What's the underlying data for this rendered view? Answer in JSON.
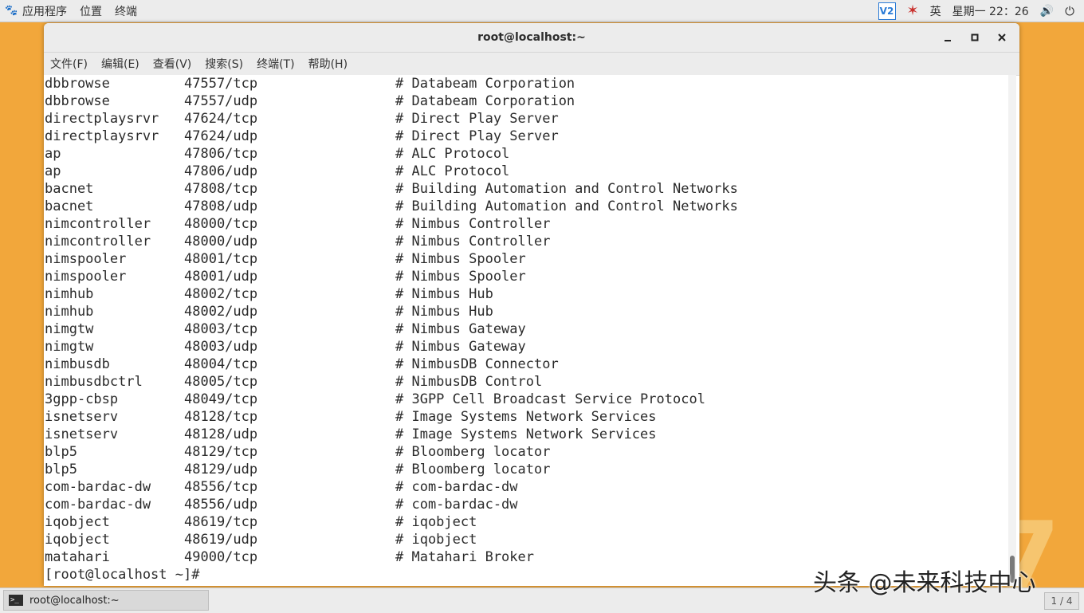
{
  "desktop": {
    "decor": "7"
  },
  "top_panel": {
    "apps": "应用程序",
    "places": "位置",
    "terminal": "终端",
    "tray_v": "V2",
    "ime": "英",
    "clock": "星期一 22：26"
  },
  "window": {
    "title": "root@localhost:~",
    "menu": [
      "文件(F)",
      "编辑(E)",
      "查看(V)",
      "搜索(S)",
      "终端(T)",
      "帮助(H)"
    ]
  },
  "terminal": {
    "lines": [
      {
        "name": "dbbrowse",
        "port": "47557/tcp",
        "desc": "# Databeam Corporation"
      },
      {
        "name": "dbbrowse",
        "port": "47557/udp",
        "desc": "# Databeam Corporation"
      },
      {
        "name": "directplaysrvr",
        "port": "47624/tcp",
        "desc": "# Direct Play Server"
      },
      {
        "name": "directplaysrvr",
        "port": "47624/udp",
        "desc": "# Direct Play Server"
      },
      {
        "name": "ap",
        "port": "47806/tcp",
        "desc": "# ALC Protocol"
      },
      {
        "name": "ap",
        "port": "47806/udp",
        "desc": "# ALC Protocol"
      },
      {
        "name": "bacnet",
        "port": "47808/tcp",
        "desc": "# Building Automation and Control Networks"
      },
      {
        "name": "bacnet",
        "port": "47808/udp",
        "desc": "# Building Automation and Control Networks"
      },
      {
        "name": "nimcontroller",
        "port": "48000/tcp",
        "desc": "# Nimbus Controller"
      },
      {
        "name": "nimcontroller",
        "port": "48000/udp",
        "desc": "# Nimbus Controller"
      },
      {
        "name": "nimspooler",
        "port": "48001/tcp",
        "desc": "# Nimbus Spooler"
      },
      {
        "name": "nimspooler",
        "port": "48001/udp",
        "desc": "# Nimbus Spooler"
      },
      {
        "name": "nimhub",
        "port": "48002/tcp",
        "desc": "# Nimbus Hub"
      },
      {
        "name": "nimhub",
        "port": "48002/udp",
        "desc": "# Nimbus Hub"
      },
      {
        "name": "nimgtw",
        "port": "48003/tcp",
        "desc": "# Nimbus Gateway"
      },
      {
        "name": "nimgtw",
        "port": "48003/udp",
        "desc": "# Nimbus Gateway"
      },
      {
        "name": "nimbusdb",
        "port": "48004/tcp",
        "desc": "# NimbusDB Connector"
      },
      {
        "name": "nimbusdbctrl",
        "port": "48005/tcp",
        "desc": "# NimbusDB Control"
      },
      {
        "name": "3gpp-cbsp",
        "port": "48049/tcp",
        "desc": "# 3GPP Cell Broadcast Service Protocol"
      },
      {
        "name": "isnetserv",
        "port": "48128/tcp",
        "desc": "# Image Systems Network Services"
      },
      {
        "name": "isnetserv",
        "port": "48128/udp",
        "desc": "# Image Systems Network Services"
      },
      {
        "name": "blp5",
        "port": "48129/tcp",
        "desc": "# Bloomberg locator"
      },
      {
        "name": "blp5",
        "port": "48129/udp",
        "desc": "# Bloomberg locator"
      },
      {
        "name": "com-bardac-dw",
        "port": "48556/tcp",
        "desc": "# com-bardac-dw"
      },
      {
        "name": "com-bardac-dw",
        "port": "48556/udp",
        "desc": "# com-bardac-dw"
      },
      {
        "name": "iqobject",
        "port": "48619/tcp",
        "desc": "# iqobject"
      },
      {
        "name": "iqobject",
        "port": "48619/udp",
        "desc": "# iqobject"
      },
      {
        "name": "matahari",
        "port": "49000/tcp",
        "desc": "# Matahari Broker"
      }
    ],
    "prompt": "[root@localhost ~]#"
  },
  "taskbar": {
    "task_label": "root@localhost:~",
    "pager": "1 / 4"
  },
  "watermark": "头条 @未来科技中心"
}
